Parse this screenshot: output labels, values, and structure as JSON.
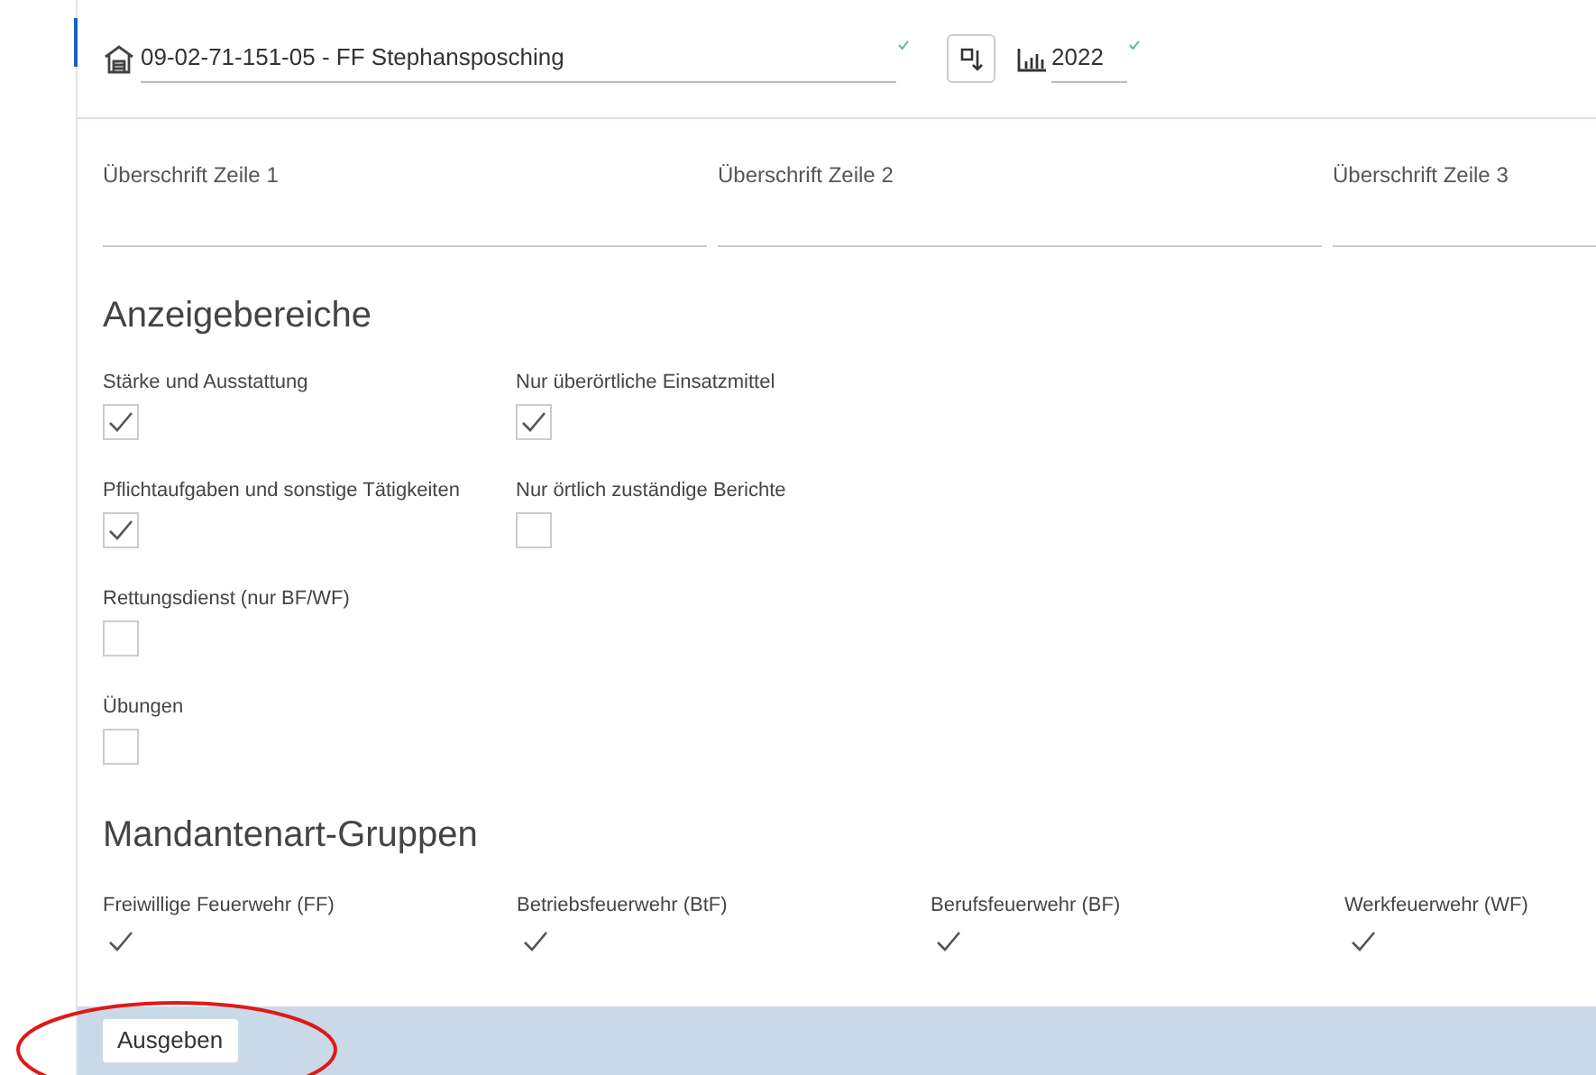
{
  "header": {
    "organisation": "09-02-71-151-05 - FF Stephansposching",
    "organisation_valid": true,
    "year": "2022",
    "year_valid": true
  },
  "headings": [
    {
      "label": "Überschrift Zeile 1"
    },
    {
      "label": "Überschrift Zeile 2"
    },
    {
      "label": "Überschrift Zeile 3"
    }
  ],
  "display_areas": {
    "title": "Anzeigebereiche",
    "options": [
      {
        "label": "Stärke und Ausstattung",
        "checked": true
      },
      {
        "label": "Nur überörtliche Einsatzmittel",
        "checked": true
      },
      {
        "label": "Pflichtaufgaben und sonstige Tätigkeiten",
        "checked": true
      },
      {
        "label": "Nur örtlich zuständige Berichte",
        "checked": false
      },
      {
        "label": "Rettungsdienst (nur BF/WF)",
        "checked": false
      },
      {
        "label": "Übungen",
        "checked": false
      }
    ]
  },
  "groups": {
    "title": "Mandantenart-Gruppen",
    "options": [
      {
        "label": "Freiwillige Feuerwehr (FF)",
        "checked": true
      },
      {
        "label": "Betriebsfeuerwehr (BtF)",
        "checked": true
      },
      {
        "label": "Berufsfeuerwehr (BF)",
        "checked": true
      },
      {
        "label": "Werkfeuerwehr (WF)",
        "checked": true
      }
    ]
  },
  "action": {
    "label": "Ausgeben"
  }
}
